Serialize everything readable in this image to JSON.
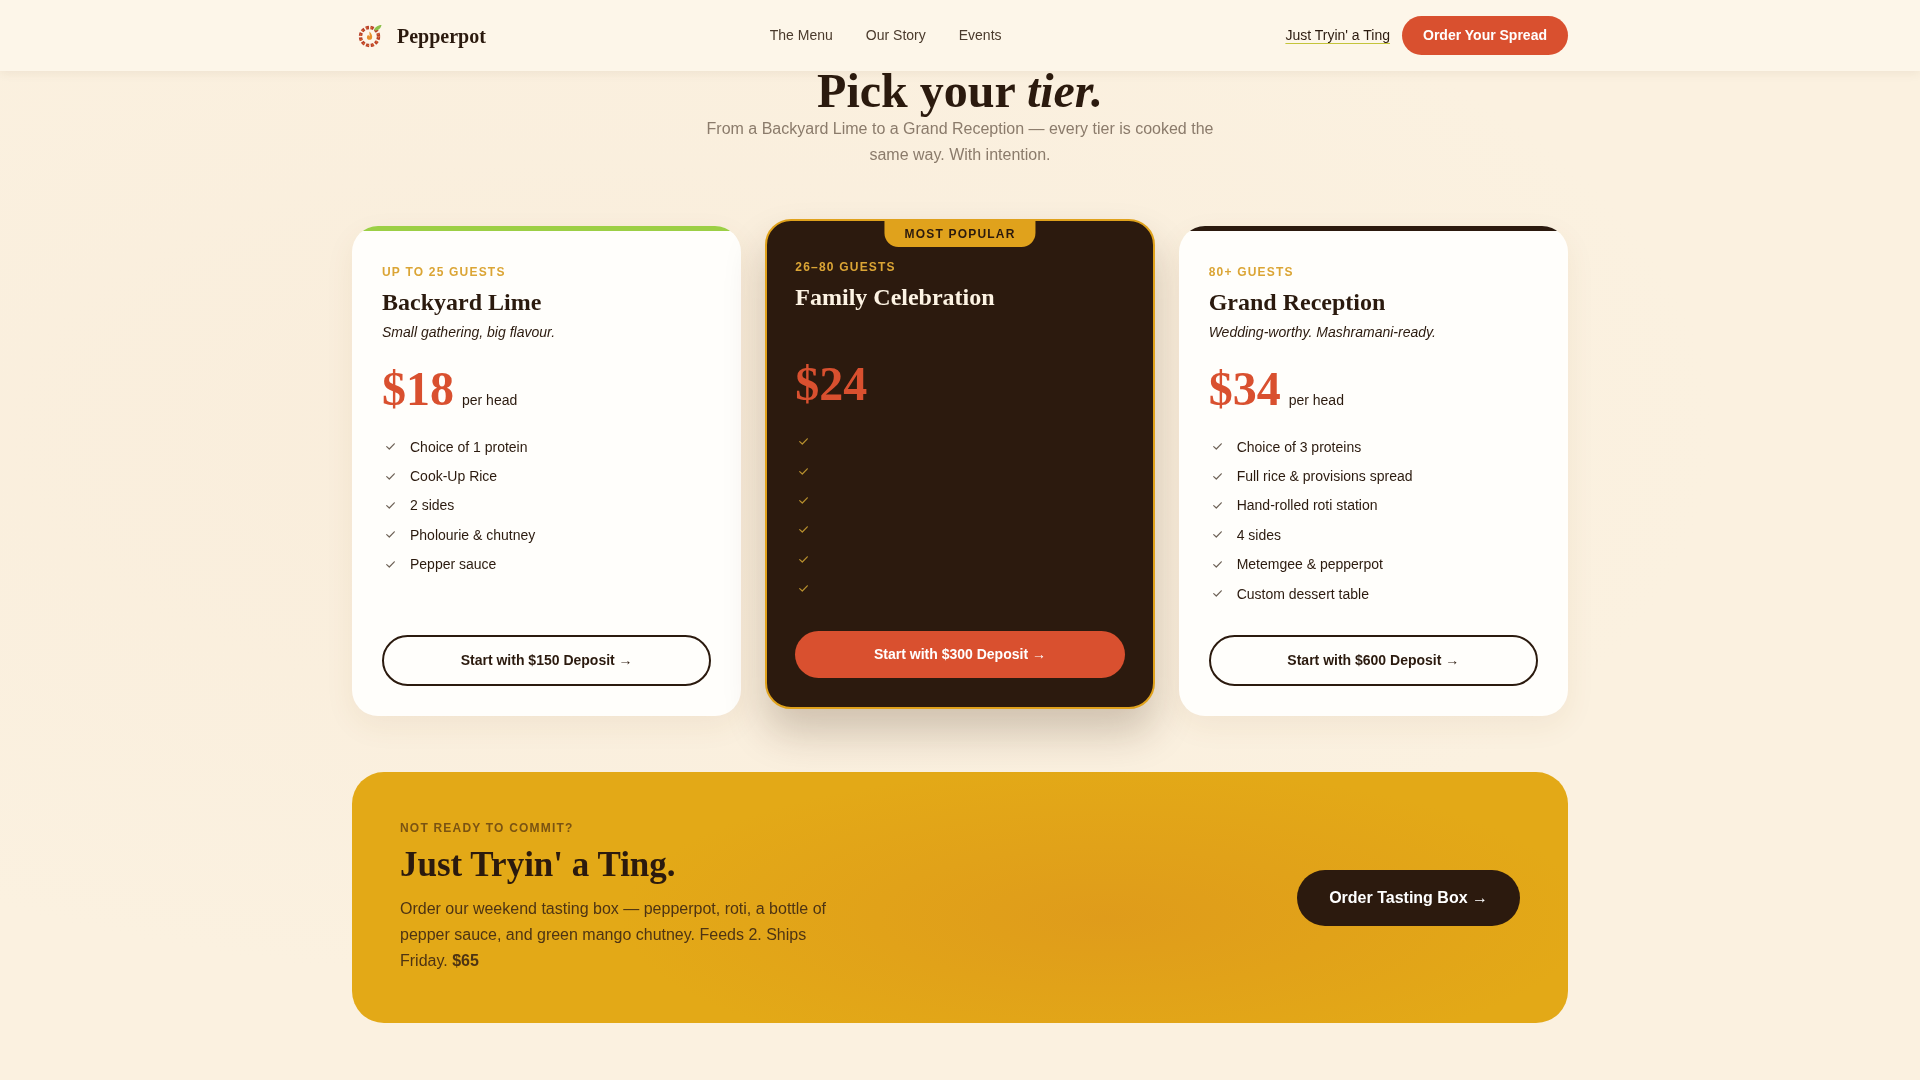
{
  "nav": {
    "brand": "Pepperpot",
    "links": [
      {
        "label": "The Menu"
      },
      {
        "label": "Our Story"
      },
      {
        "label": "Events"
      }
    ],
    "secondary_link": "Just Tryin' a Ting",
    "cta": "Order Your Spread"
  },
  "header": {
    "title": "Pick your *tier.*",
    "subtitle": "From a Backyard Lime to a Grand Reception — every tier is cooked the same way. With intention."
  },
  "tiers": [
    {
      "guests": "UP TO 25 GUESTS",
      "name": "Backyard Lime",
      "tagline": "Small gathering, big flavour.",
      "price": "$18",
      "unit": "per head",
      "featured": false,
      "color": "#9ccf45",
      "features": [
        {
          "kind": "check",
          "text": "Choice of 1 protein"
        },
        {
          "kind": "check",
          "text": "Cook-Up Rice"
        },
        {
          "kind": "check",
          "text": "2 sides"
        },
        {
          "kind": "check",
          "text": "Pholourie & chutney"
        },
        {
          "kind": "check",
          "text": "Pepper sauce"
        }
      ],
      "button": "Start with $150 Deposit →"
    },
    {
      "badge": "MOST POPULAR",
      "guests": "26–80 GUESTS",
      "name": "Family Celebration",
      "price": "$24",
      "featured": true,
      "features": [
        {
          "kind": "check"
        },
        {
          "kind": "check"
        },
        {
          "kind": "check"
        },
        {
          "kind": "check"
        },
        {
          "kind": "check"
        },
        {
          "kind": "check"
        }
      ],
      "button": "Start with $300 Deposit →"
    },
    {
      "guests": "80+ GUESTS",
      "name": "Grand Reception",
      "tagline": "Wedding-worthy. Mashramani-ready.",
      "price": "$34",
      "unit": "per head",
      "featured": false,
      "color": "#2c1a0e",
      "features": [
        {
          "kind": "check",
          "text": "Choice of 3 proteins"
        },
        {
          "kind": "check",
          "text": "Full rice & provisions spread"
        },
        {
          "kind": "check",
          "text": "Hand-rolled roti station"
        },
        {
          "kind": "check",
          "text": "4 sides"
        },
        {
          "kind": "check",
          "text": "Metemgee & pepperpot"
        },
        {
          "kind": "check",
          "text": "Custom dessert table"
        }
      ],
      "button": "Start with $600 Deposit →"
    }
  ],
  "promo": {
    "eyebrow": "NOT READY TO COMMIT?",
    "title": "Just Tryin' a Ting.",
    "text": "Order our weekend tasting box — pepperpot, roti, a bottle of pepper sauce, and green mango chutney. Feeds 2. Ships Friday. **$65**",
    "button": "Order Tasting Box →"
  }
}
